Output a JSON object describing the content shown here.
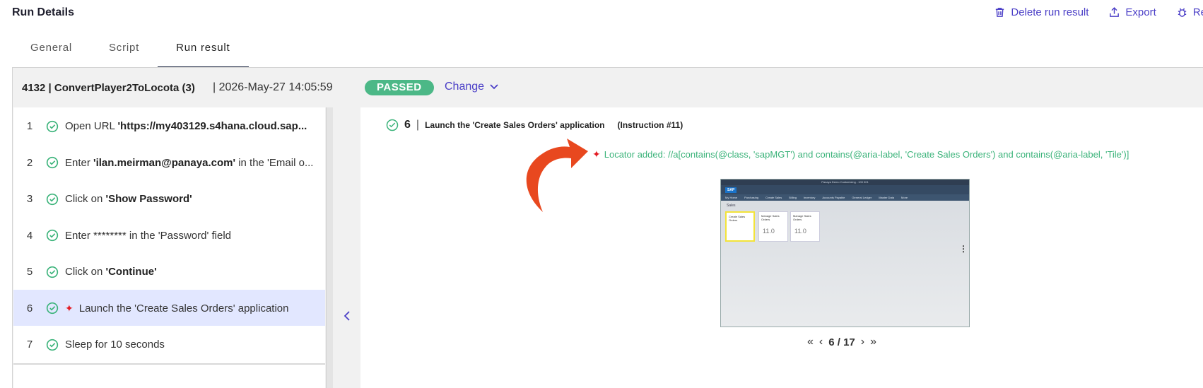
{
  "page": {
    "title": "Run Details"
  },
  "header_actions": [
    {
      "label": "Delete run result",
      "icon": "trash-icon"
    },
    {
      "label": "Export",
      "icon": "export-icon"
    },
    {
      "label": "Report bug",
      "icon": "bug-icon"
    }
  ],
  "tabs": [
    {
      "label": "General",
      "active": false
    },
    {
      "label": "Script",
      "active": false
    },
    {
      "label": "Run result",
      "active": true
    }
  ],
  "run": {
    "id_name": "4132 | ConvertPlayer2ToLocota (3)",
    "date": "| 2026-May-27 14:05:59",
    "status": "PASSED",
    "status_color": "#4cb887",
    "change_label": "Change"
  },
  "steps": [
    {
      "num": "1",
      "pre": "Open URL ",
      "bold": "'https://my403129.s4hana.cloud.sap...",
      "post": "",
      "locator_added": false
    },
    {
      "num": "2",
      "pre": "Enter ",
      "bold": "'ilan.meirman@panaya.com'",
      "post": " in the 'Email o...",
      "locator_added": false
    },
    {
      "num": "3",
      "pre": "Click on ",
      "bold": "'Show Password'",
      "post": "",
      "locator_added": false
    },
    {
      "num": "4",
      "pre": "Enter ******** in the 'Password' field",
      "bold": "",
      "post": "",
      "locator_added": false
    },
    {
      "num": "5",
      "pre": "Click on ",
      "bold": "'Continue'",
      "post": "",
      "locator_added": false
    },
    {
      "num": "6",
      "pre": "Launch the 'Create Sales Orders' application",
      "bold": "",
      "post": "",
      "locator_added": true
    },
    {
      "num": "7",
      "pre": "Sleep for 10 seconds",
      "bold": "",
      "post": "",
      "locator_added": false
    }
  ],
  "detail": {
    "step_num": "6",
    "separator": "|",
    "title": "Launch the 'Create Sales Orders' application",
    "instruction": "(Instruction #11)",
    "locator_text": "Locator added: //a[contains(@class, 'sapMGT') and contains(@aria-label, 'Create Sales Orders') and contains(@aria-label, 'Tile')]",
    "pager": "6 / 17"
  },
  "screenshot": {
    "window_title": "Panaya Demo Customizing - 100 001",
    "logo": "SAP",
    "nav": [
      "My Home",
      "Purchasing",
      "Create Sales",
      "Billing",
      "Inventory",
      "Accounts Payable",
      "General Ledger",
      "Master Data",
      "More"
    ],
    "section": "Sales",
    "tiles": [
      {
        "label": "Create Sales Orders",
        "count": ""
      },
      {
        "label": "Manage Sales Orders",
        "count": "11.0"
      },
      {
        "label": "Manage Sales Orders",
        "count": "11.0"
      }
    ]
  },
  "colors": {
    "accent": "#4b3fc7",
    "success": "#3bb37a",
    "arrow": "#e8481f",
    "selected_row": "#e2e7ff"
  }
}
